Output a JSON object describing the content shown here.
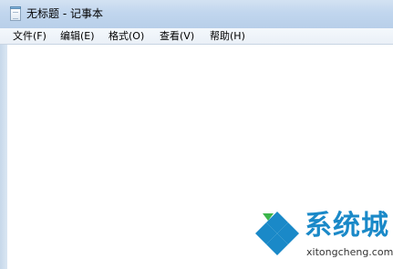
{
  "window": {
    "title": "无标题 - 记事本"
  },
  "menu": {
    "items": [
      "文件(F)",
      "编辑(E)",
      "格式(O)",
      "查看(V)",
      "帮助(H)"
    ]
  },
  "editor": {
    "content": ""
  },
  "watermark": {
    "brand": "系统城",
    "url": "xitongcheng.com"
  },
  "colors": {
    "titlebar": "#c1d6ee",
    "menubar": "#eaf0f7",
    "watermark_blue": "#1a89c8",
    "logo_green": "#3bb54a"
  }
}
